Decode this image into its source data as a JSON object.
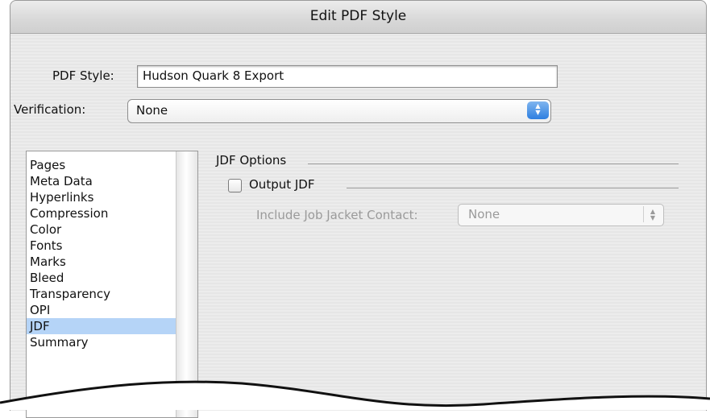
{
  "window": {
    "title": "Edit PDF Style"
  },
  "form": {
    "pdf_style_label": "PDF Style:",
    "pdf_style_value": "Hudson Quark 8 Export",
    "verification_label": "Verification:",
    "verification_value": "None"
  },
  "sidebar": {
    "items": [
      {
        "label": "Pages"
      },
      {
        "label": "Meta Data"
      },
      {
        "label": "Hyperlinks"
      },
      {
        "label": "Compression"
      },
      {
        "label": "Color"
      },
      {
        "label": "Fonts"
      },
      {
        "label": "Marks"
      },
      {
        "label": "Bleed"
      },
      {
        "label": "Transparency"
      },
      {
        "label": "OPI"
      },
      {
        "label": "JDF"
      },
      {
        "label": "Summary"
      }
    ],
    "selected": "JDF"
  },
  "jdf": {
    "group_title": "JDF Options",
    "output_jdf_label": "Output JDF",
    "output_jdf_checked": false,
    "contact_label": "Include Job Jacket Contact:",
    "contact_value": "None"
  },
  "icons": {
    "popup_arrows": "up-down-arrows-icon"
  },
  "colors": {
    "selection": "#b5d4f7",
    "popup_accent": "#2e7fe0"
  }
}
